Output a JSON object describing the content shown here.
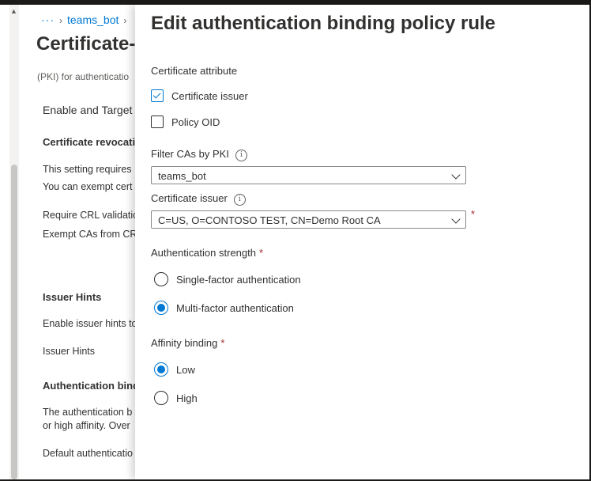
{
  "breadcrumb": {
    "ellipsis": "···",
    "item": "teams_bot"
  },
  "background": {
    "title": "Certificate-",
    "description_cut": "(PKI) for authenticatio",
    "enable_target": "Enable and Target",
    "crl_heading": "Certificate revocatio",
    "setting_requires": "This setting requires",
    "exempt_cert": "You can exempt cert",
    "require_crl": "Require CRL validatio",
    "exempt_cas": "Exempt CAs from CR",
    "issuer_hints_heading": "Issuer Hints",
    "enable_issuer_hints": "Enable issuer hints to",
    "issuer_hints": "Issuer Hints",
    "auth_binding_heading": "Authentication bind",
    "auth_binding_desc1": "The authentication b",
    "auth_binding_desc2": "or high affinity. Over",
    "default_auth": "Default authenticatio"
  },
  "panel": {
    "title": "Edit authentication binding policy rule",
    "cert_attribute_label": "Certificate attribute",
    "checkboxes": [
      {
        "label": "Certificate issuer",
        "checked": true
      },
      {
        "label": "Policy OID",
        "checked": false
      }
    ],
    "filter_label": "Filter CAs by PKI",
    "filter_value": "teams_bot",
    "issuer_label": "Certificate issuer",
    "issuer_value": "C=US, O=CONTOSO TEST, CN=Demo Root CA",
    "required_mark": "*",
    "auth_strength_label": "Authentication strength",
    "auth_strength_options": [
      {
        "label": "Single-factor authentication",
        "selected": false
      },
      {
        "label": "Multi-factor authentication",
        "selected": true
      }
    ],
    "affinity_label": "Affinity binding",
    "affinity_options": [
      {
        "label": "Low",
        "selected": true
      },
      {
        "label": "High",
        "selected": false
      }
    ],
    "info_glyph": "i"
  }
}
